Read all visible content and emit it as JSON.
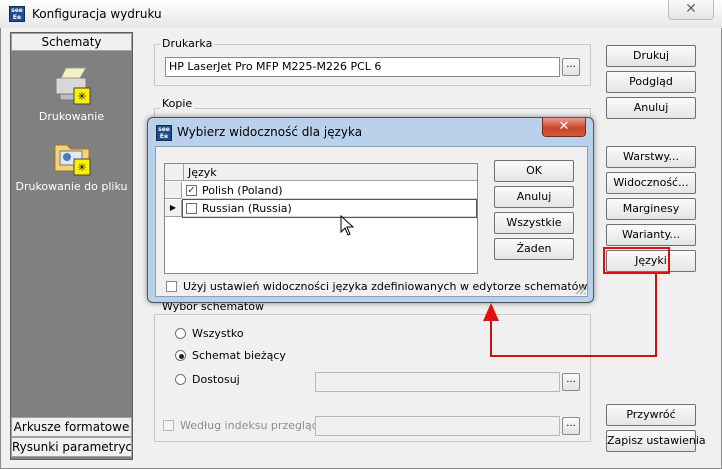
{
  "window": {
    "title": "Konfiguracja wydruku",
    "close_glyph": "✕",
    "app_icon": "see-icon",
    "app_icon_text": "see"
  },
  "sidebar": {
    "header": "Schematy",
    "items": [
      {
        "label": "Drukowanie",
        "icon": "printer-icon"
      },
      {
        "label": "Drukowanie do pliku",
        "icon": "print-to-file-icon"
      }
    ],
    "footer": [
      "Arkusze formatowe",
      "Rysunki parametryczne"
    ]
  },
  "printer_group": {
    "label": "Drukarka",
    "value": "HP LaserJet Pro MFP M225-M226 PCL 6",
    "browse": "..."
  },
  "copies_group": {
    "label": "Kopie"
  },
  "schema_group": {
    "label": "Wybór schematów",
    "options": [
      {
        "label": "Wszystko",
        "selected": false
      },
      {
        "label": "Schemat bieżący",
        "selected": true
      },
      {
        "label": "Dostosuj",
        "selected": false
      }
    ],
    "browse": "...",
    "index_checkbox_label": "Według indeksu przeglądu",
    "index_browse": "..."
  },
  "right_buttons": {
    "top": [
      "Drukuj",
      "Podgląd",
      "Anuluj"
    ],
    "middle": [
      "Warstwy...",
      "Widoczność...",
      "Marginesy",
      "Warianty...",
      "Języki"
    ],
    "bottom": [
      "Przywróć",
      "Zapisz ustawienia"
    ]
  },
  "dialog": {
    "title": "Wybierz widoczność dla języka",
    "close_glyph": "✕",
    "column_header": "Język",
    "rows": [
      {
        "label": "Polish (Poland)",
        "checked": true,
        "current": false
      },
      {
        "label": "Russian (Russia)",
        "checked": false,
        "current": true
      }
    ],
    "check_glyph": "✓",
    "row_pointer_glyph": "▶",
    "buttons": [
      "OK",
      "Anuluj",
      "Wszystkie",
      "Żaden"
    ],
    "footer_checkbox_label": "Użyj ustawień widoczności języka zdefiniowanych w edytorze schematów"
  },
  "colors": {
    "annotation": "#e01010",
    "dialog_frame": "#b9d1ea",
    "sidebar_bg": "#808080"
  }
}
